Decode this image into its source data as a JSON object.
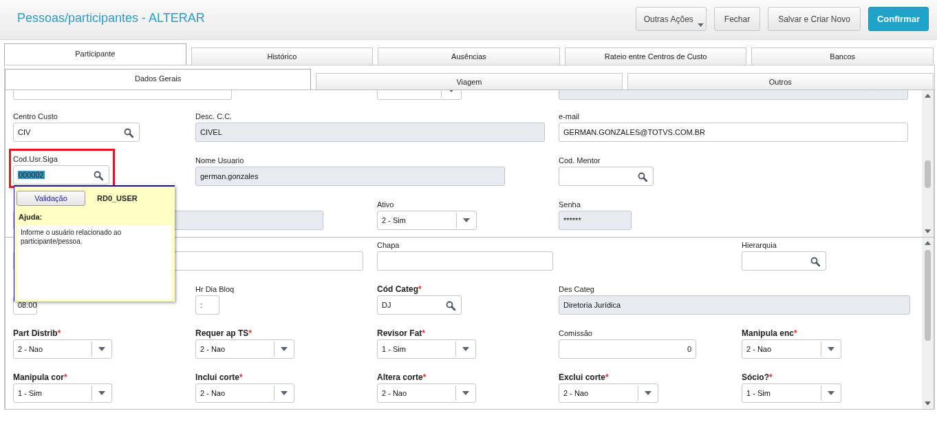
{
  "window": {
    "title": "Pessoas/participantes - ALTERAR"
  },
  "actions": [
    {
      "label": "Outras Ações",
      "kind": "menu"
    },
    {
      "label": "Fechar",
      "kind": "default"
    },
    {
      "label": "Salvar e Criar Novo",
      "kind": "default"
    },
    {
      "label": "Confirmar",
      "kind": "primary"
    }
  ],
  "tabs": [
    {
      "label": "Participante",
      "selected": true
    },
    {
      "label": "Histórico",
      "selected": false
    },
    {
      "label": "Ausências",
      "selected": false
    },
    {
      "label": "Rateio entre Centros de Custo",
      "selected": false
    },
    {
      "label": "Bancos",
      "selected": false
    }
  ],
  "subtabs": [
    {
      "label": "Dados Gerais",
      "selected": true
    },
    {
      "label": "Viagem",
      "selected": false
    },
    {
      "label": "Outros",
      "selected": false
    }
  ],
  "panels": [
    {
      "rows": [
        [
          {
            "kind": "text"
          },
          "",
          {
            "kind": "select"
          },
          {
            "kind": "readonly"
          }
        ],
        [
          {
            "label": "Centro Custo",
            "kind": "lookup",
            "value": "CIV"
          },
          {
            "label": "Desc. C.C.",
            "kind": "readonly",
            "value": "CIVEL"
          },
          "",
          {
            "label": "e-mail",
            "kind": "text",
            "value": "GERMAN.GONZALES@TOTVS.COM.BR"
          }
        ],
        [
          {
            "label": "Cod.Usr.Siga",
            "kind": "lookup",
            "value": "000002",
            "highlighted": true,
            "value_selected": true
          },
          {
            "label": "Nome Usuario",
            "kind": "readonly",
            "value": "german.gonzales"
          },
          "",
          {
            "label": "Cod. Mentor",
            "kind": "lookup"
          }
        ],
        [
          {
            "kind": "readonly"
          },
          "",
          {
            "label": "Ativo",
            "kind": "select",
            "value": "2 - Sim"
          },
          {
            "label": "Senha",
            "kind": "readonly",
            "value": "******"
          }
        ]
      ]
    },
    {
      "rows": [
        [
          {
            "kind": "text"
          },
          "",
          {
            "label": "Chapa",
            "kind": "text"
          },
          "",
          {
            "label": "Hierarquia",
            "kind": "lookup"
          }
        ],
        [
          {
            "kind": "text",
            "value": "08:00"
          },
          {
            "label": "Hr Dia Bloq",
            "kind": "text",
            "value": ":"
          },
          {
            "label": "Cód Categ",
            "kind": "lookup",
            "value": "DJ",
            "required": true,
            "required_mark": "*"
          },
          {
            "label": "Des Categ",
            "kind": "readonly",
            "value": "Diretoria Jurídica"
          }
        ],
        [
          {
            "label": "Part Distrib",
            "kind": "select",
            "value": "2 - Nao",
            "required": true,
            "required_mark": "*"
          },
          {
            "label": "Requer ap TS",
            "kind": "select",
            "value": "2 - Nao",
            "required": true,
            "required_mark": "*"
          },
          {
            "label": "Revisor Fat",
            "kind": "select",
            "value": "1 - Sim",
            "required": true,
            "required_mark": "*"
          },
          {
            "label": "Comissão",
            "kind": "number",
            "value": "0"
          },
          {
            "label": "Manipula enc",
            "kind": "select",
            "value": "2 - Nao",
            "required": true,
            "required_mark": "*"
          }
        ],
        [
          {
            "label": "Manipula cor",
            "kind": "select",
            "value": "1 - Sim",
            "required": true,
            "required_mark": "*"
          },
          {
            "label": "Inclui corte",
            "kind": "select",
            "value": "2 - Nao",
            "required": true,
            "required_mark": "*"
          },
          {
            "label": "Altera corte",
            "kind": "select",
            "value": "2 - Nao",
            "required": true,
            "required_mark": "*"
          },
          {
            "label": "Exclui corte",
            "kind": "select",
            "value": "2 - Nao",
            "required": true,
            "required_mark": "*"
          },
          {
            "label": "Sócio?",
            "kind": "select",
            "value": "1 - Sim",
            "required": true,
            "required_mark": "*"
          }
        ]
      ]
    }
  ],
  "help_popup": {
    "button": "Validação",
    "field_code": "RD0_USER",
    "heading": "Ajuda:",
    "text": "Informe o usuário relacionado ao participante/pessoa."
  }
}
